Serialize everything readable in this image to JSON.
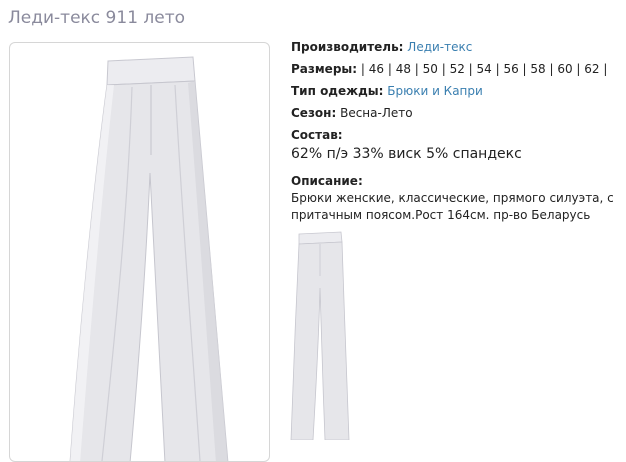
{
  "product": {
    "title": "Леди-текс 911 лето"
  },
  "details": {
    "manufacturer_label": "Производитель:",
    "manufacturer_value": "Леди-текс",
    "sizes_label": "Размеры:",
    "sizes_value": "| 46 | 48 | 50 | 52 | 54 | 56 | 58 | 60 | 62 |",
    "clothing_type_label": "Тип одежды:",
    "clothing_type_value": "Брюки и Капри",
    "season_label": "Сезон:",
    "season_value": "Весна-Лето",
    "composition_label": "Состав:",
    "composition_value": "62% п/э 33% виск 5% спандекс",
    "description_label": "Описание:",
    "description_value": "Брюки женские, классические, прямого силуэта, с притачным поясом.Рост 164см. пр-во Беларусь"
  },
  "colors": {
    "title": "#8a8a9c",
    "link": "#3a7fb0",
    "pants": "#e8e8ec",
    "pants_shadow": "#c9c9d1"
  }
}
